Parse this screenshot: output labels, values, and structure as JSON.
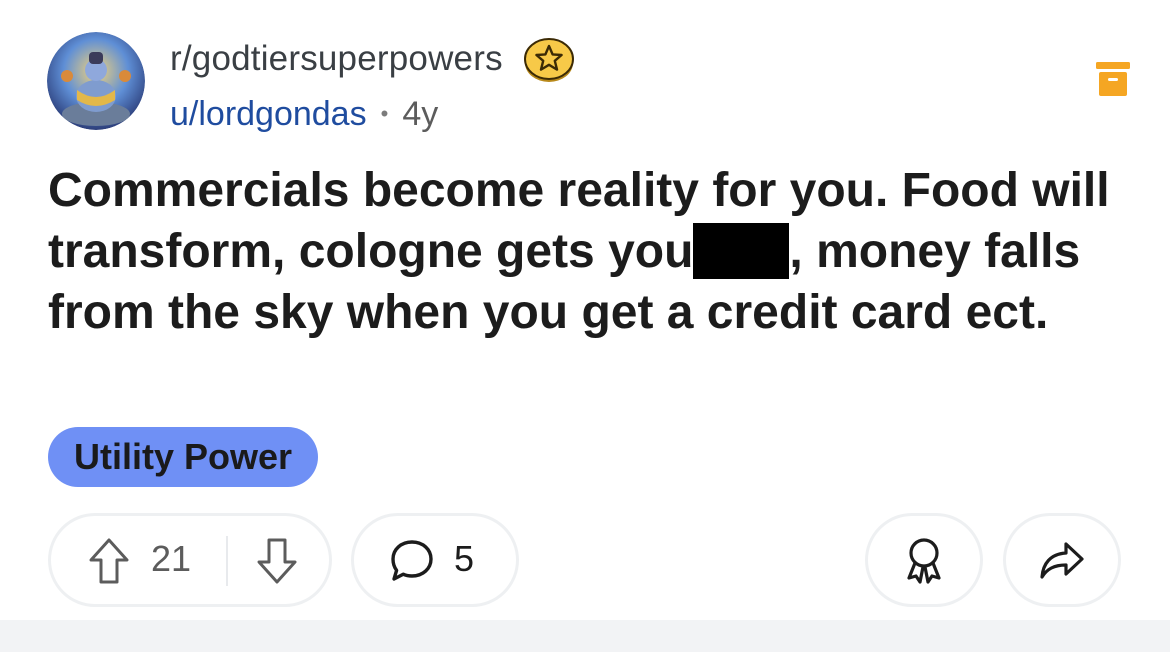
{
  "post": {
    "subreddit": "r/godtiersuperpowers",
    "username": "u/lordgondas",
    "separator": "•",
    "age": "4y",
    "body_before_redaction": "Commercials become reality for you. Food will transform, cologne gets you",
    "body_after_redaction": ", money falls from the sky when you get a credit card ect.",
    "flair": "Utility Power",
    "flair_color": "#6f90f5",
    "upvotes": "21",
    "comments": "5"
  },
  "icons": {
    "badge": "star-badge-icon",
    "archive": "archive-icon",
    "upvote": "arrow-up-icon",
    "downvote": "arrow-down-icon",
    "comment": "speech-bubble-icon",
    "award": "award-ribbon-icon",
    "share": "share-arrow-icon"
  },
  "colors": {
    "username": "#1f4c9f",
    "archive": "#f5a623",
    "badge": "#f7c948"
  }
}
